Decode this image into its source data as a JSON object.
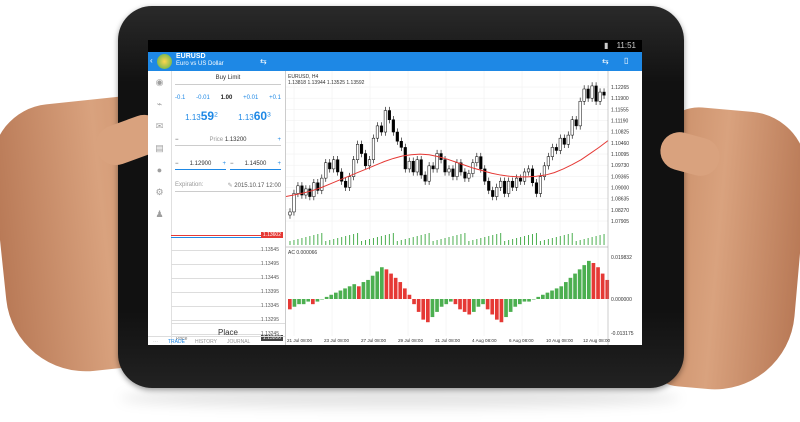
{
  "status_bar": {
    "time": "11:51"
  },
  "action_bar": {
    "symbol": "EURUSD",
    "description": "Euro vs US Dollar",
    "back_icon": "chevron-left-icon",
    "swap_icon": "arrows-icon",
    "new_order_icon": "document-icon"
  },
  "sidebar_icons": [
    "quotes-icon",
    "chart-icon",
    "mail-icon",
    "news-icon",
    "chat-icon",
    "settings-icon",
    "account-icon"
  ],
  "order": {
    "type": "Buy Limit",
    "volume_steps": [
      "-0.1",
      "-0.01",
      "1.00",
      "+0.01",
      "+0.1"
    ],
    "bid_prefix": "1.13",
    "bid_big": "59",
    "bid_sup": "2",
    "ask_prefix": "1.13",
    "ask_big": "60",
    "ask_sup": "3",
    "price_label": "Price",
    "price_value": "1.13200",
    "minus": "−",
    "plus": "+",
    "sl_value": "1.12900",
    "tp_value": "1.14500",
    "expiration_label": "Expiration:",
    "expiration_value": "2015.10.17 12:00",
    "edit_icon": "pencil-icon"
  },
  "ladder": {
    "levels": [
      "1.13545",
      "1.13495",
      "1.13445",
      "1.13395",
      "1.13345",
      "1.13295",
      "1.13245"
    ],
    "bid_tag": "1.13602",
    "price_label": "Price",
    "price_tag": "1.13200"
  },
  "place_button": "Place",
  "tabs": [
    "TRADE",
    "HISTORY",
    "JOURNAL"
  ],
  "chart_data": [
    {
      "type": "candlestick",
      "title": "EURUSD, H4",
      "ohlc_text": "1.13818 1.13944 1.13525 1.13592",
      "y_ticks": [
        "1.12265",
        "1.11900",
        "1.11555",
        "1.11190",
        "1.10825",
        "1.10460",
        "1.10095",
        "1.09730",
        "1.09365",
        "1.09000",
        "1.08635",
        "1.08270",
        "1.07905"
      ],
      "x_ticks": [
        "21 Jul 08:00",
        "23 Jul 08:00",
        "27 Jul 08:00",
        "29 Jul 08:00",
        "31 Jul 08:00",
        "4 Aug 08:00",
        "6 Aug 08:00",
        "10 Aug 08:00",
        "12 Aug 08:00"
      ],
      "close": [
        1.082,
        1.088,
        1.0905,
        1.0875,
        1.0895,
        1.087,
        1.0915,
        1.089,
        1.093,
        1.098,
        1.096,
        1.099,
        1.095,
        1.092,
        1.09,
        1.0935,
        1.099,
        1.104,
        1.101,
        1.097,
        1.099,
        1.106,
        1.11,
        1.108,
        1.115,
        1.112,
        1.108,
        1.105,
        1.103,
        1.096,
        1.0985,
        1.095,
        1.099,
        1.094,
        1.092,
        1.097,
        1.096,
        1.101,
        1.099,
        1.095,
        1.096,
        1.0935,
        1.098,
        1.095,
        1.093,
        1.0945,
        1.098,
        1.1,
        1.096,
        1.092,
        1.089,
        1.087,
        1.09,
        1.092,
        1.088,
        1.092,
        1.09,
        1.093,
        1.092,
        1.095,
        1.096,
        1.0915,
        1.088,
        1.0935,
        1.097,
        1.1,
        1.103,
        1.102,
        1.106,
        1.104,
        1.107,
        1.112,
        1.11,
        1.118,
        1.122,
        1.119,
        1.123,
        1.118,
        1.121,
        1.12
      ],
      "moving_average": [
        1.087,
        1.0876,
        1.0882,
        1.089,
        1.09,
        1.0912,
        1.0924,
        1.0936,
        1.0948,
        1.096,
        1.0972,
        1.0984,
        1.0994,
        1.1002,
        1.1006,
        1.1008,
        1.1006,
        1.1,
        1.0992,
        1.0982,
        1.0972,
        1.0962,
        1.0954,
        1.0946,
        1.094,
        1.0936,
        1.0934,
        1.0934,
        1.0936,
        1.094,
        1.0948,
        1.096,
        1.0974,
        1.099,
        1.101,
        1.103,
        1.1052
      ],
      "ac_label": "AC 0.000066",
      "ac_ticks": [
        "0.019832",
        "0.000000",
        "-0.013175"
      ],
      "ac_values": [
        -0.004,
        -0.003,
        -0.002,
        -0.002,
        -0.001,
        -0.002,
        -0.001,
        0.0,
        0.001,
        0.002,
        0.003,
        0.004,
        0.005,
        0.006,
        0.007,
        0.006,
        0.008,
        0.009,
        0.011,
        0.013,
        0.015,
        0.014,
        0.012,
        0.01,
        0.008,
        0.005,
        0.002,
        -0.002,
        -0.005,
        -0.008,
        -0.009,
        -0.007,
        -0.005,
        -0.003,
        -0.002,
        -0.001,
        -0.002,
        -0.004,
        -0.005,
        -0.006,
        -0.005,
        -0.003,
        -0.002,
        -0.004,
        -0.006,
        -0.008,
        -0.009,
        -0.007,
        -0.005,
        -0.003,
        -0.002,
        -0.001,
        -0.001,
        0.0,
        0.001,
        0.002,
        0.003,
        0.004,
        0.005,
        0.006,
        0.008,
        0.01,
        0.012,
        0.014,
        0.016,
        0.018,
        0.017,
        0.015,
        0.012,
        0.009
      ]
    }
  ]
}
